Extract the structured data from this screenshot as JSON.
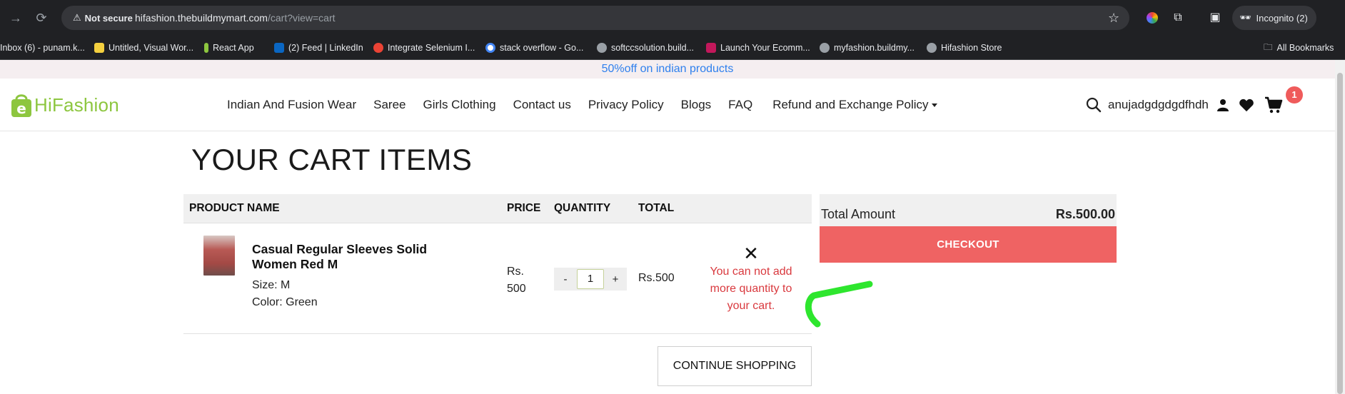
{
  "browser": {
    "security_label": "Not secure",
    "url_host": "hifashion.thebuildmymart.com",
    "url_path": "/cart?view=cart",
    "profile_label": "Incognito (2)",
    "bookmarks": [
      {
        "label": "Inbox (6) - punam.k...",
        "color": "#d93025"
      },
      {
        "label": "Untitled, Visual Wor...",
        "color": "#f4d03f"
      },
      {
        "label": "React App",
        "color": "#8dc63f"
      },
      {
        "label": "(2) Feed | LinkedIn",
        "color": "#0a66c2"
      },
      {
        "label": "Integrate Selenium I...",
        "color": "#ea4335"
      },
      {
        "label": "stack overflow - Go...",
        "color": "#4285f4"
      },
      {
        "label": "softccsolution.build...",
        "color": "#9aa0a6"
      },
      {
        "label": "Launch Your Ecomm...",
        "color": "#c2185b"
      },
      {
        "label": "myfashion.buildmy...",
        "color": "#9aa0a6"
      },
      {
        "label": "Hifashion Store",
        "color": "#9aa0a6"
      }
    ],
    "all_bookmarks_label": "All Bookmarks"
  },
  "promo": {
    "text": "50%off on indian products"
  },
  "header": {
    "logo_hi": "Hi",
    "logo_fashion": "Fashion",
    "menu": [
      "Indian And Fusion Wear",
      "Saree",
      "Girls Clothing",
      "Contact us",
      "Privacy Policy",
      "Blogs",
      "FAQ",
      "Refund and Exchange Policy"
    ],
    "username": "anujadgdgdgdfhdh",
    "cart_count": "1"
  },
  "cart": {
    "title": "YOUR CART ITEMS",
    "columns": {
      "product": "PRODUCT NAME",
      "price": "PRICE",
      "quantity": "QUANTITY",
      "total": "TOTAL"
    },
    "item": {
      "name": "Casual Regular Sleeves Solid Women Red M",
      "size": "Size: M",
      "color": "Color: Green",
      "price_prefix": "Rs.",
      "price_value": "500",
      "quantity": "1",
      "minus": "-",
      "plus": "+",
      "total": "Rs.500",
      "remove": "✕",
      "error": "You can not add more quantity to your cart."
    },
    "continue_label": "CONTINUE SHOPPING"
  },
  "summary": {
    "label": "Total Amount",
    "value": "Rs.500.00",
    "checkout_label": "CHECKOUT"
  },
  "colors": {
    "brand_green": "#8dc63f",
    "checkout_red": "#ef6363",
    "error_red": "#d9393e",
    "promo_blue": "#2f80ed",
    "annotation_green": "#2ee62e"
  }
}
